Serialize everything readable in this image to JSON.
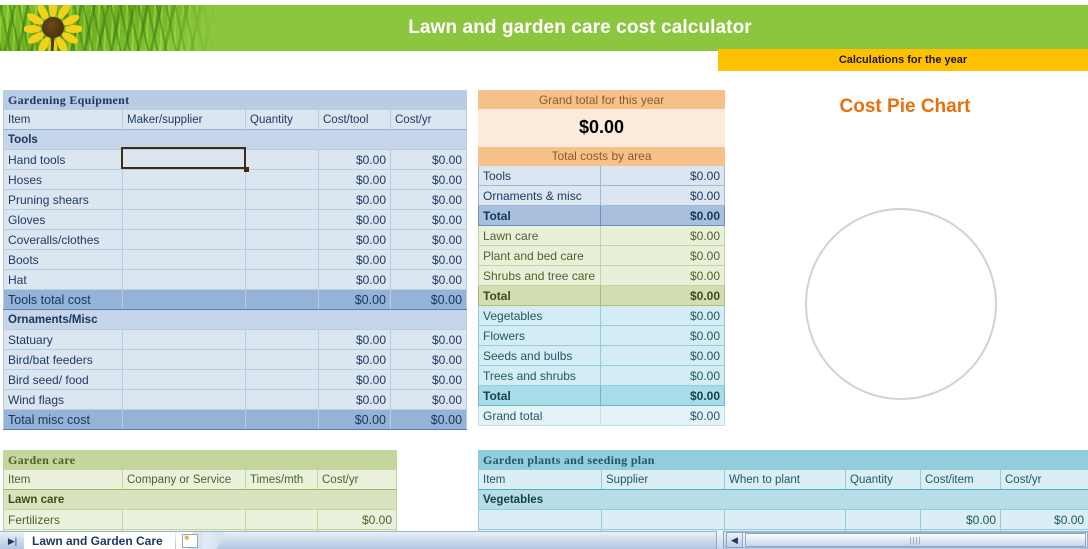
{
  "banner": {
    "title": "Lawn and garden care cost calculator",
    "calculations_label": "Calculations for the year",
    "photo_icon": "sunflower-photo",
    "brand_green": "#8CC63E",
    "brand_yellow": "#FFC000"
  },
  "equipment": {
    "section_title": "Gardening Equipment",
    "columns": [
      "Item",
      "Maker/supplier",
      "Quantity",
      "Cost/tool",
      "Cost/yr"
    ],
    "groups": [
      {
        "name": "Tools",
        "rows": [
          {
            "item": "Hand tools",
            "supplier": "",
            "qty": "",
            "cost_tool": "$0.00",
            "cost_yr": "$0.00"
          },
          {
            "item": "Hoses",
            "supplier": "",
            "qty": "",
            "cost_tool": "$0.00",
            "cost_yr": "$0.00"
          },
          {
            "item": "Pruning shears",
            "supplier": "",
            "qty": "",
            "cost_tool": "$0.00",
            "cost_yr": "$0.00"
          },
          {
            "item": "Gloves",
            "supplier": "",
            "qty": "",
            "cost_tool": "$0.00",
            "cost_yr": "$0.00"
          },
          {
            "item": "Coveralls/clothes",
            "supplier": "",
            "qty": "",
            "cost_tool": "$0.00",
            "cost_yr": "$0.00"
          },
          {
            "item": "Boots",
            "supplier": "",
            "qty": "",
            "cost_tool": "$0.00",
            "cost_yr": "$0.00"
          },
          {
            "item": "Hat",
            "supplier": "",
            "qty": "",
            "cost_tool": "$0.00",
            "cost_yr": "$0.00"
          }
        ],
        "total": {
          "label": "Tools total cost",
          "cost_tool": "$0.00",
          "cost_yr": "$0.00"
        }
      },
      {
        "name": "Ornaments/Misc",
        "rows": [
          {
            "item": "Statuary",
            "supplier": "",
            "qty": "",
            "cost_tool": "$0.00",
            "cost_yr": "$0.00"
          },
          {
            "item": "Bird/bat feeders",
            "supplier": "",
            "qty": "",
            "cost_tool": "$0.00",
            "cost_yr": "$0.00"
          },
          {
            "item": "Bird seed/ food",
            "supplier": "",
            "qty": "",
            "cost_tool": "$0.00",
            "cost_yr": "$0.00"
          },
          {
            "item": "Wind flags",
            "supplier": "",
            "qty": "",
            "cost_tool": "$0.00",
            "cost_yr": "$0.00"
          }
        ],
        "total": {
          "label": "Total misc cost",
          "cost_tool": "$0.00",
          "cost_yr": "$0.00"
        }
      }
    ]
  },
  "summary": {
    "grand_total_header": "Grand total for this year",
    "grand_total_value": "$0.00",
    "by_area_header": "Total costs by area",
    "rows": [
      {
        "label": "Tools",
        "value": "$0.00",
        "style": "blue"
      },
      {
        "label": "Ornaments & misc",
        "value": "$0.00",
        "style": "blue"
      },
      {
        "label": "Total",
        "value": "$0.00",
        "style": "blue-total"
      },
      {
        "label": "Lawn care",
        "value": "$0.00",
        "style": "green"
      },
      {
        "label": "Plant and bed care",
        "value": "$0.00",
        "style": "green"
      },
      {
        "label": "Shrubs and tree care",
        "value": "$0.00",
        "style": "green"
      },
      {
        "label": "Total",
        "value": "$0.00",
        "style": "green-total"
      },
      {
        "label": "Vegetables",
        "value": "$0.00",
        "style": "cyan"
      },
      {
        "label": "Flowers",
        "value": "$0.00",
        "style": "cyan"
      },
      {
        "label": "Seeds and bulbs",
        "value": "$0.00",
        "style": "cyan"
      },
      {
        "label": "Trees and shrubs",
        "value": "$0.00",
        "style": "cyan"
      },
      {
        "label": "Total",
        "value": "$0.00",
        "style": "cyan-total"
      },
      {
        "label": "Grand total",
        "value": "$0.00",
        "style": "grand"
      }
    ]
  },
  "chart_data": {
    "type": "pie",
    "title": "Cost Pie Chart",
    "title_color": "#E8700A",
    "categories": [
      "Tools",
      "Ornaments & misc",
      "Lawn care",
      "Plant and bed care",
      "Shrubs and tree care",
      "Vegetables",
      "Flowers",
      "Seeds and bulbs",
      "Trees and shrubs"
    ],
    "values": [
      0,
      0,
      0,
      0,
      0,
      0,
      0,
      0,
      0
    ],
    "total": 0,
    "legend": "none",
    "note": "All values are zero, so the pie renders as an empty outlined circle with no slices."
  },
  "garden_care": {
    "section_title": "Garden care",
    "columns": [
      "Item",
      "Company or Service",
      "Times/mth",
      "Cost/yr"
    ],
    "group": "Lawn care",
    "rows": [
      {
        "item": "Fertilizers",
        "company": "",
        "times": "",
        "cost_yr": "$0.00"
      },
      {
        "item": "",
        "company": "",
        "times": "",
        "cost_yr": ""
      }
    ]
  },
  "plants_plan": {
    "section_title": "Garden plants and seeding plan",
    "columns": [
      "Item",
      "Supplier",
      "When to plant",
      "Quantity",
      "Cost/item",
      "Cost/yr"
    ],
    "group": "Vegetables",
    "rows": [
      {
        "item": "",
        "supplier": "",
        "when": "",
        "qty": "",
        "cost_item": "$0.00",
        "cost_yr": "$0.00"
      },
      {
        "item": "",
        "supplier": "",
        "when": "",
        "qty": "",
        "cost_item": "",
        "cost_yr": ""
      }
    ]
  },
  "statusbar": {
    "sheet_tab": "Lawn and Garden Care",
    "nav_last_icon": "nav-last-sheet-icon",
    "new_sheet_icon": "new-sheet-icon",
    "scroll_left_icon": "scroll-left-arrow-icon"
  }
}
